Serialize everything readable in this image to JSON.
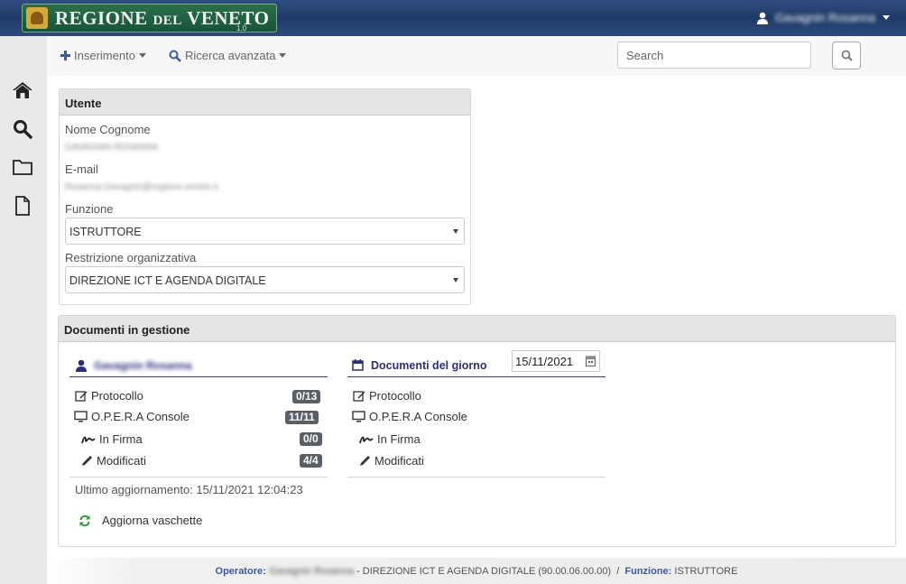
{
  "header": {
    "brand_main": "REGIONE",
    "brand_small": "DEL",
    "brand_last": "VENETO",
    "version": "1.0",
    "user_name": "Gavagnin Rosanna"
  },
  "sidebar": {
    "items": [
      {
        "icon": "home-icon"
      },
      {
        "icon": "search-icon"
      },
      {
        "icon": "folder-icon"
      },
      {
        "icon": "document-icon"
      }
    ]
  },
  "toolbar": {
    "insert_label": "Inserimento",
    "advanced_search_label": "Ricerca avanzata",
    "search_placeholder": "Search"
  },
  "utente": {
    "title": "Utente",
    "name_label": "Nome Cognome",
    "name_value": "GAVAGNIN ROSANNA",
    "email_label": "E-mail",
    "email_value": "Rosanna.Gavagnin@regione.veneto.it",
    "funzione_label": "Funzione",
    "funzione_value": "ISTRUTTORE",
    "restrizione_label": "Restrizione organizzativa",
    "restrizione_value": "DIREZIONE ICT E AGENDA DIGITALE"
  },
  "documenti": {
    "title": "Documenti in gestione",
    "left": {
      "owner": "Gavagnin Rosanna",
      "rows": [
        {
          "label": "Protocollo",
          "count": "0/13"
        },
        {
          "label": "O.P.E.R.A Console",
          "count": "11/11"
        },
        {
          "label": "In Firma",
          "count": "0/0"
        },
        {
          "label": "Modificati",
          "count": "4/4"
        }
      ],
      "last_update": "Ultimo aggiornamento: 15/11/2021 12:04:23",
      "refresh_label": "Aggiorna vaschette"
    },
    "right": {
      "title": "Documenti del giorno",
      "date": "15/11/2021",
      "rows": [
        {
          "label": "Protocollo"
        },
        {
          "label": "O.P.E.R.A Console"
        },
        {
          "label": "In Firma"
        },
        {
          "label": "Modificati"
        }
      ]
    }
  },
  "footer": {
    "operator_label": "Operatore:",
    "operator_name": "Gavagnin Rosanna",
    "org": " - DIREZIONE ICT E AGENDA DIGITALE (90.00.06.00.00)  /  ",
    "funzione_label": "Funzione:",
    "funzione_value": " ISTRUTTORE"
  },
  "colors": {
    "header_blue": "#2b4a7d",
    "accent_navy": "#2c2f7a",
    "badge_gray": "#5a5f66",
    "refresh_green": "#2e9a3e"
  }
}
